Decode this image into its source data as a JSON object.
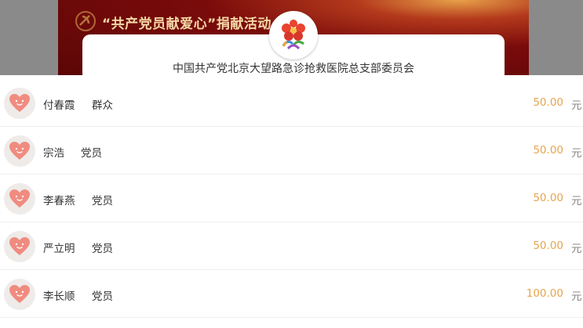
{
  "banner": {
    "title": "“共产党员献爱心”捐献活动"
  },
  "organization": {
    "name": "中国共产党北京大望路急诊抢救医院总支部委员会"
  },
  "donations": [
    {
      "name": "付春霞",
      "role": "群众",
      "amount": "50.00",
      "unit": "元"
    },
    {
      "name": "宗浩",
      "role": "党员",
      "amount": "50.00",
      "unit": "元"
    },
    {
      "name": "李春燕",
      "role": "党员",
      "amount": "50.00",
      "unit": "元"
    },
    {
      "name": "严立明",
      "role": "党员",
      "amount": "50.00",
      "unit": "元"
    },
    {
      "name": "李长顺",
      "role": "党员",
      "amount": "100.00",
      "unit": "元"
    }
  ],
  "colors": {
    "banner": "#7a0b0b",
    "amount": "#e5a54c",
    "heart": "#f08b80",
    "avatar_bg": "#eeebe9"
  },
  "icons": {
    "avatar": "heart-icon",
    "org_logo": "flower-logo-icon",
    "banner_emblem": "party-emblem-icon"
  }
}
